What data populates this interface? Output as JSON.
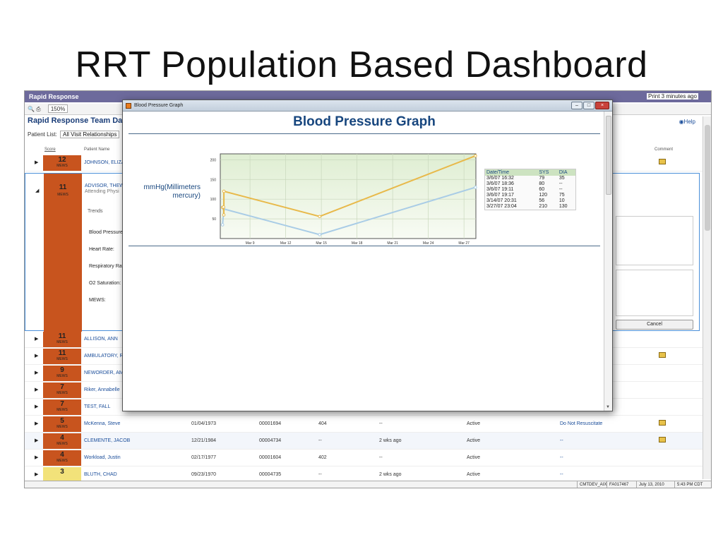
{
  "slide": {
    "title": "RRT Population Based Dashboard"
  },
  "app": {
    "bar_title": "Rapid Response",
    "bar_right": "Print  3 minutes ago",
    "toolbar_zoom": "150%",
    "header_title": "Rapid Response Team Dash",
    "help_label": "Help",
    "patient_list_label": "Patient List:",
    "patient_list_value": "All Visit Relationships",
    "col_score": "Score",
    "col_name": "Patient Name",
    "col_comment": "Comment",
    "rows_top": [
      {
        "score": "12",
        "unit": "MEWS",
        "name": "JOHNSON, ELIZA"
      }
    ],
    "expanded": {
      "score": "11",
      "unit": "MEWS",
      "name": "ADVISOR, THEW",
      "attending": "Attending Physi",
      "trends": "Trends",
      "vitals": [
        "Blood Pressure",
        "Heart Rate:",
        "Respiratory Rat",
        "O2 Saturation:",
        "MEWS:"
      ],
      "cancel": "Cancel"
    },
    "rows": [
      {
        "score": "11",
        "unit": "MEWS",
        "name": "ALLISON, ANN",
        "dob": "",
        "mrn": "",
        "room": "",
        "los": "",
        "status": "",
        "code": "",
        "note": false
      },
      {
        "score": "11",
        "unit": "MEWS",
        "name": "AMBULATORY, R",
        "dob": "",
        "mrn": "",
        "room": "",
        "los": "",
        "status": "",
        "code": "",
        "note": true
      },
      {
        "score": "9",
        "unit": "MEWS",
        "name": "NEWORDER, AM",
        "dob": "",
        "mrn": "",
        "room": "",
        "los": "",
        "status": "",
        "code": "",
        "note": false
      },
      {
        "score": "7",
        "unit": "MEWS",
        "name": "Riker, Annabelle",
        "dob": "",
        "mrn": "",
        "room": "",
        "los": "",
        "status": "",
        "code": "",
        "note": false
      },
      {
        "score": "7",
        "unit": "MEWS",
        "name": "TEST, FALL",
        "dob": "",
        "mrn": "",
        "room": "",
        "los": "",
        "status": "",
        "code": "",
        "note": false
      },
      {
        "score": "5",
        "unit": "MEWS",
        "name": "McKenna, Steve",
        "dob": "01/04/1973",
        "mrn": "00001694",
        "room": "404",
        "los": "--",
        "status": "Active",
        "code": "Do Not Resuscitate",
        "note": true
      },
      {
        "score": "4",
        "unit": "MEWS",
        "name": "CLEMENTE, JACOB",
        "dob": "12/21/1984",
        "mrn": "00004734",
        "room": "--",
        "los": "2 wks ago",
        "status": "Active",
        "code": "--",
        "note": true
      },
      {
        "score": "4",
        "unit": "MEWS",
        "name": "Workload, Justin",
        "dob": "02/17/1977",
        "mrn": "00001604",
        "room": "402",
        "los": "--",
        "status": "Active",
        "code": "--",
        "note": false
      },
      {
        "score": "3",
        "unit": "",
        "name": "BLUTH, CHAD",
        "dob": "09/23/1970",
        "mrn": "00004735",
        "room": "--",
        "los": "2 wks ago",
        "status": "Active",
        "code": "--",
        "note": false
      }
    ],
    "statusbar": [
      "CMTDEV_AIX",
      "FA017467",
      "July 13, 2010",
      "5:43 PM CDT"
    ]
  },
  "dialog": {
    "window_title": "Blood Pressure Graph",
    "header": "Blood Pressure Graph",
    "ylabel": "mmHg(Millimeters mercury)",
    "table": {
      "headers": [
        "Date/Time",
        "SYS",
        "DIA"
      ],
      "rows": [
        [
          "3/6/07 16:32",
          "79",
          "35"
        ],
        [
          "3/6/07 18:36",
          "80",
          "--"
        ],
        [
          "3/6/07 19:11",
          "60",
          "--"
        ],
        [
          "3/6/07 19:17",
          "120",
          "75"
        ],
        [
          "3/14/07 20:31",
          "56",
          "10"
        ],
        [
          "3/27/07 23:04",
          "210",
          "130"
        ]
      ]
    }
  },
  "chart_data": {
    "type": "line",
    "title": "Blood Pressure Graph",
    "xlabel": "",
    "ylabel": "mmHg(Millimeters mercury)",
    "x_ticks": [
      "Mar 9",
      "Mar 12",
      "Mar 15",
      "Mar 18",
      "Mar 21",
      "Mar 24",
      "Mar 27"
    ],
    "y_ticks": [
      50,
      100,
      150,
      200
    ],
    "ylim": [
      0,
      215
    ],
    "grid": true,
    "x": [
      "3/6/07 16:32",
      "3/6/07 18:36",
      "3/6/07 19:11",
      "3/6/07 19:17",
      "3/14/07 20:31",
      "3/27/07 23:04"
    ],
    "series": [
      {
        "name": "SYS",
        "color": "#e8b94a",
        "points": [
          [
            "3/6/07 16:32",
            79
          ],
          [
            "3/6/07 18:36",
            80
          ],
          [
            "3/6/07 19:11",
            60
          ],
          [
            "3/6/07 19:17",
            120
          ],
          [
            "3/14/07 20:31",
            56
          ],
          [
            "3/27/07 23:04",
            210
          ]
        ]
      },
      {
        "name": "DIA",
        "color": "#a9cce6",
        "points": [
          [
            "3/6/07 16:32",
            35
          ],
          [
            "3/6/07 19:17",
            75
          ],
          [
            "3/14/07 20:31",
            10
          ],
          [
            "3/27/07 23:04",
            130
          ]
        ]
      }
    ]
  }
}
